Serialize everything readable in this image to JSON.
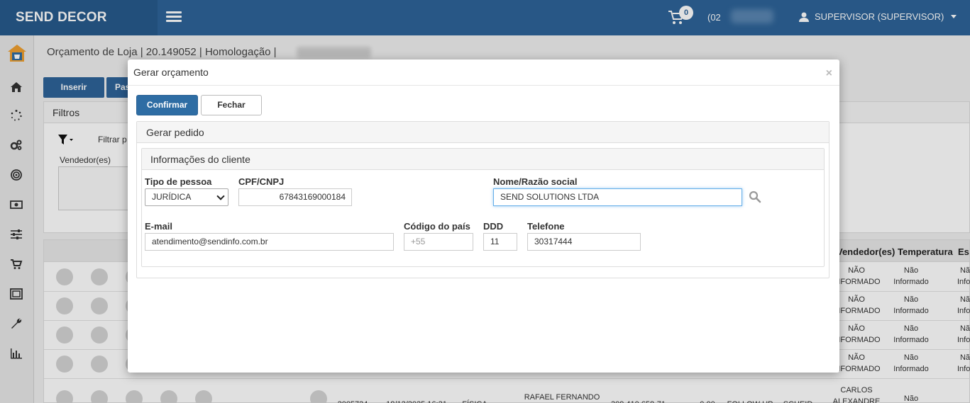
{
  "topbar": {
    "brand": "SEND DECOR",
    "cart_count": "0",
    "phone_prefix": "(02",
    "user_label": "SUPERVISOR (SUPERVISOR)"
  },
  "page": {
    "breadcrumb": "Orçamento de Loja | 20.149052 | Homologação |",
    "insert_label": "Inserir",
    "second_label": "Pas",
    "filters_title": "Filtros",
    "filter_text": "Filtrar p",
    "vendor_label": "Vendedor(es)"
  },
  "grid": {
    "headers": {
      "vendedores": "Vendedor(es)",
      "temperatura": "Temperatura",
      "es": "Es"
    },
    "rows": [
      {
        "vend1": "NÃO",
        "vend2": "INFORMADO",
        "temp1": "Não",
        "temp2": "Informado",
        "es1": "Nã",
        "es2": "Infor"
      },
      {
        "vend1": "NÃO",
        "vend2": "INFORMADO",
        "temp1": "Não",
        "temp2": "Informado",
        "es1": "Nã",
        "es2": "Infor"
      },
      {
        "vend1": "NÃO",
        "vend2": "INFORMADO",
        "temp1": "Não",
        "temp2": "Informado",
        "es1": "Nã",
        "es2": "Infor"
      },
      {
        "vend1": "NÃO",
        "vend2": "INFORMADO",
        "temp1": "Não",
        "temp2": "Informado",
        "es1": "Nã",
        "es2": "Infor"
      }
    ],
    "last_row": {
      "code": "2005724",
      "date": "18/12/2025 16:21",
      "type": "FÍSICA",
      "name": "RAFAEL FERNANDO",
      "doc": "309.410.658-71",
      "value": "0,00",
      "status": "FOLLOW UP",
      "user": "SCHEID",
      "vend1": "CARLOS",
      "vend2": "ALEXANDRE",
      "temp": "Não"
    }
  },
  "modal": {
    "title": "Gerar orçamento",
    "close_symbol": "×",
    "confirm_label": "Confirmar",
    "close_label": "Fechar",
    "section_title": "Gerar pedido",
    "subsection_title": "Informações do cliente",
    "fields": {
      "tipo_pessoa": {
        "label": "Tipo de pessoa",
        "value": "JURÍDICA"
      },
      "cpf_cnpj": {
        "label": "CPF/CNPJ",
        "value": "67843169000184"
      },
      "nome": {
        "label": "Nome/Razão social",
        "value": "SEND SOLUTIONS LTDA"
      },
      "email": {
        "label": "E-mail",
        "value": "atendimento@sendinfo.com.br"
      },
      "codigo_pais": {
        "label": "Código do país",
        "placeholder": "+55"
      },
      "ddd": {
        "label": "DDD",
        "value": "11"
      },
      "telefone": {
        "label": "Telefone",
        "value": "30317444"
      }
    }
  }
}
